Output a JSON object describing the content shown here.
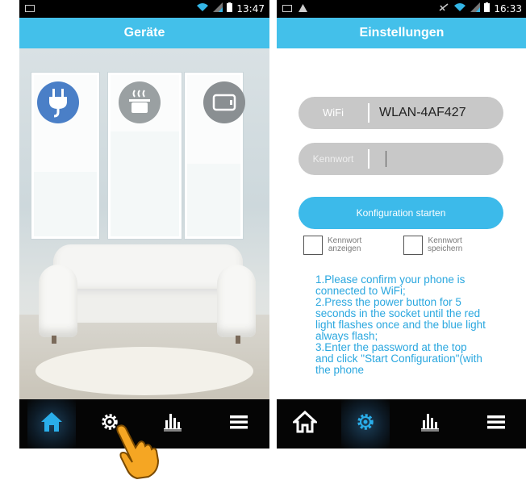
{
  "left_screen": {
    "status_time": "13:47",
    "title": "Geräte",
    "devices": [
      {
        "name": "plug-icon",
        "color": "#4a7fc7"
      },
      {
        "name": "cooking-pot-icon",
        "color": "#9aa0a2"
      },
      {
        "name": "tv-icon",
        "color": "#8a8f92"
      }
    ],
    "nav": [
      {
        "icon": "home-icon",
        "active": true
      },
      {
        "icon": "gear-icon",
        "active": false
      },
      {
        "icon": "chart-icon",
        "active": false
      },
      {
        "icon": "menu-icon",
        "active": false
      }
    ]
  },
  "right_screen": {
    "status_time": "16:33",
    "title": "Einstellungen",
    "wifi": {
      "label": "WiFi",
      "value": "WLAN-4AF427"
    },
    "password": {
      "label": "Kennwort",
      "value": ""
    },
    "start_button": "Konfiguration starten",
    "show_password": {
      "line1": "Kennwort",
      "line2": "anzeigen"
    },
    "save_password": {
      "line1": "Kennwort",
      "line2": "speichern"
    },
    "instructions": [
      "1.Please confirm your phone is connected to WiFi;",
      "2.Press the power button for 5 seconds in the socket until the red light flashes once and the blue light always flash;",
      "3.Enter the password at the top and click \"Start Configuration\"(with the phone"
    ],
    "nav": [
      {
        "icon": "home-icon",
        "active": false
      },
      {
        "icon": "gear-icon",
        "active": true
      },
      {
        "icon": "chart-icon",
        "active": false
      },
      {
        "icon": "menu-icon",
        "active": false
      }
    ]
  },
  "colors": {
    "accent": "#43c0ea",
    "instruction_text": "#2aa7df",
    "field_bg": "#c8c8c8",
    "nav_bg": "#050505"
  }
}
